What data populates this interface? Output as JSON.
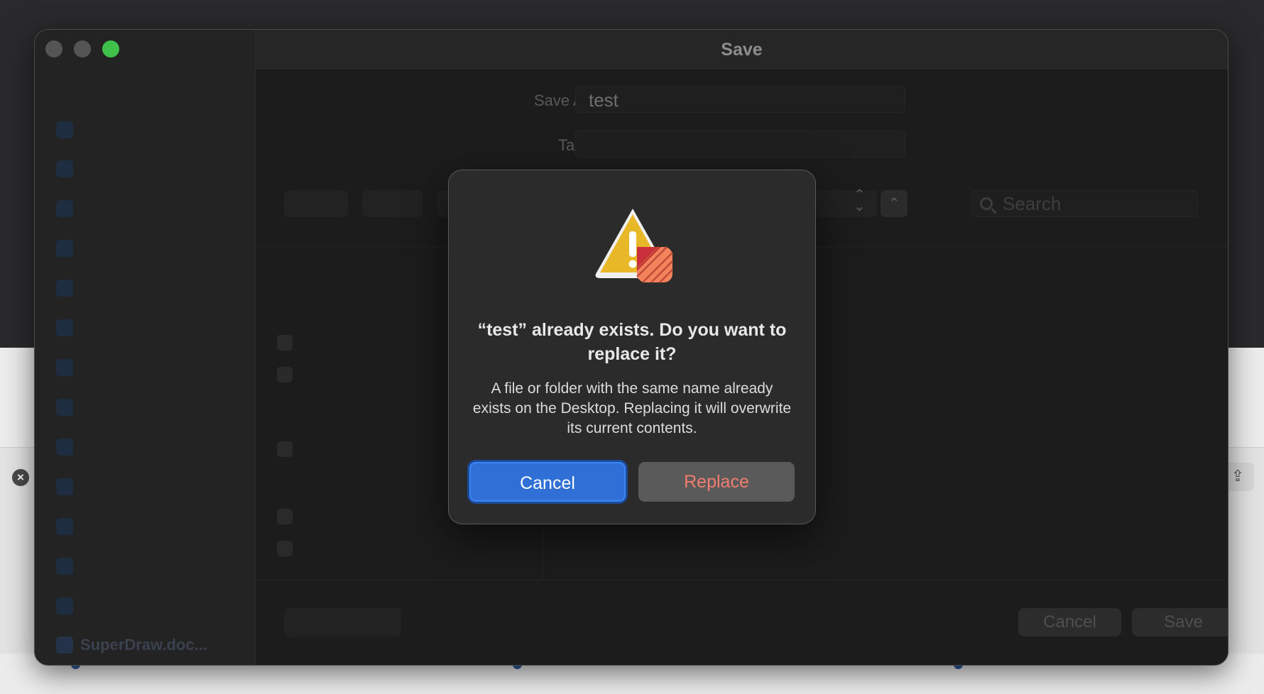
{
  "window": {
    "title": "Save",
    "save_as_label": "Save As:",
    "save_as_value": "test",
    "tags_label": "Tags:",
    "tags_value": "",
    "search_placeholder": "Search",
    "cancel_label": "Cancel",
    "save_label": "Save"
  },
  "sidebar": {
    "bottom_item": "SuperDraw.doc..."
  },
  "alert": {
    "title": "“test” already exists. Do you want to replace it?",
    "message": "A file or folder with the same name already exists on the Desktop. Replacing it will overwrite its current contents.",
    "cancel_label": "Cancel",
    "replace_label": "Replace"
  },
  "colors": {
    "accent": "#2f6fd6",
    "replace_text": "#f17d6e",
    "traffic_green": "#3fc04a"
  },
  "icons": [
    "warning-triangle-icon",
    "app-badge-icon",
    "search-icon",
    "chevron-up-icon",
    "up-down-arrows-icon",
    "close-icon",
    "share-icon"
  ]
}
